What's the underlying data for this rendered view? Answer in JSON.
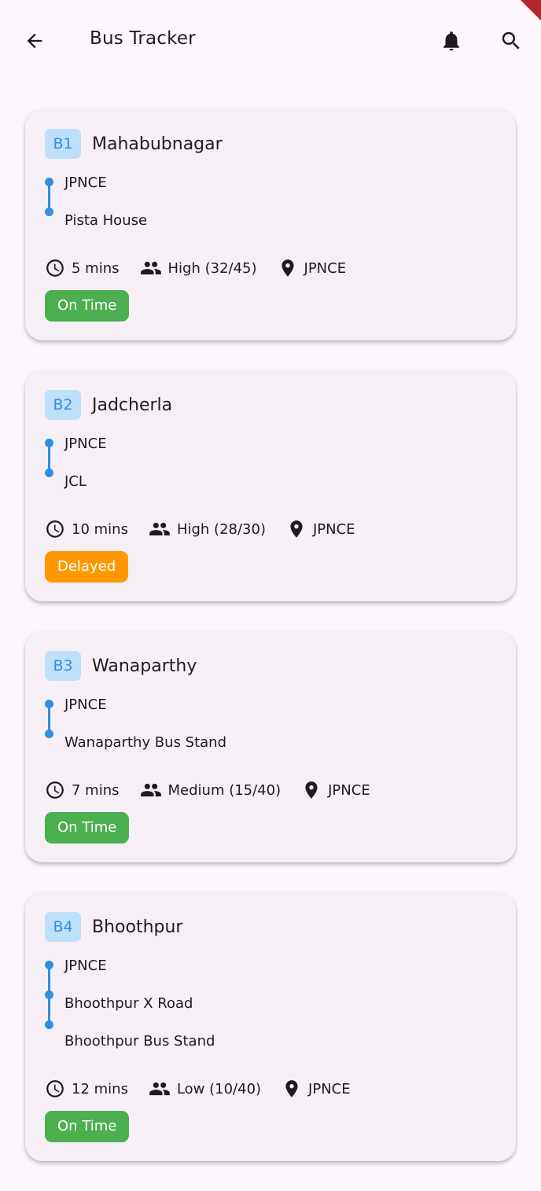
{
  "appbar": {
    "title": "Bus Tracker"
  },
  "colors": {
    "route_blue": "#2f8fe0",
    "badge_bg": "#bfe0fb",
    "on_time": "#4caf50",
    "delayed": "#ff9800"
  },
  "buses": [
    {
      "id": "B1",
      "destination": "Mahabubnagar",
      "stops": [
        "JPNCE",
        "Pista House"
      ],
      "eta": "5 mins",
      "crowd": "High (32/45)",
      "location": "JPNCE",
      "status": "On Time",
      "status_type": "ontime"
    },
    {
      "id": "B2",
      "destination": "Jadcherla",
      "stops": [
        "JPNCE",
        "JCL"
      ],
      "eta": "10 mins",
      "crowd": "High (28/30)",
      "location": "JPNCE",
      "status": "Delayed",
      "status_type": "delayed"
    },
    {
      "id": "B3",
      "destination": "Wanaparthy",
      "stops": [
        "JPNCE",
        "Wanaparthy Bus Stand"
      ],
      "eta": "7 mins",
      "crowd": "Medium (15/40)",
      "location": "JPNCE",
      "status": "On Time",
      "status_type": "ontime"
    },
    {
      "id": "B4",
      "destination": "Bhoothpur",
      "stops": [
        "JPNCE",
        "Bhoothpur X Road",
        "Bhoothpur Bus Stand"
      ],
      "eta": "12 mins",
      "crowd": "Low (10/40)",
      "location": "JPNCE",
      "status": "On Time",
      "status_type": "ontime"
    }
  ]
}
